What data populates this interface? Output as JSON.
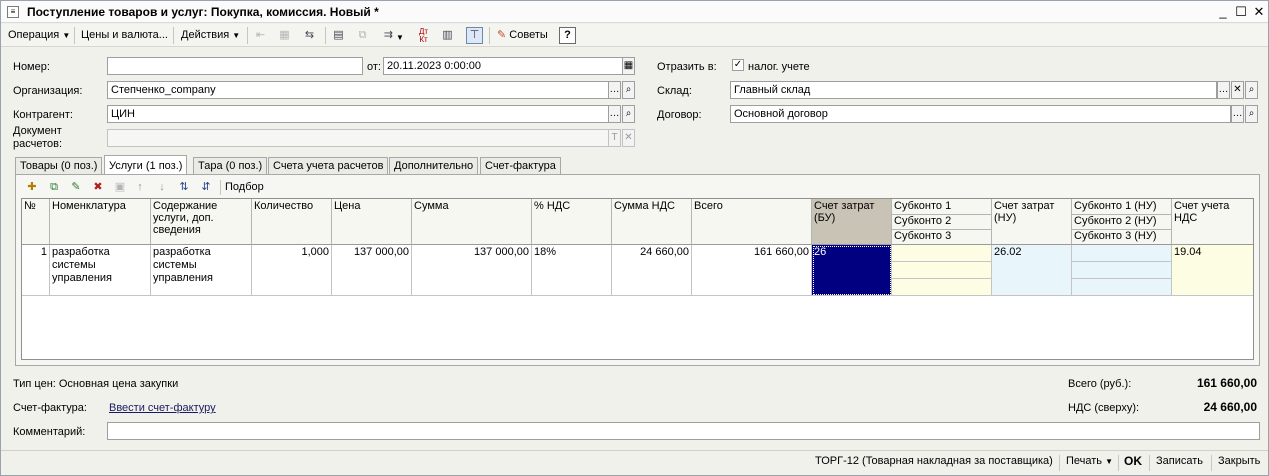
{
  "window": {
    "title": "Поступление товаров и услуг: Покупка, комиссия. Новый *",
    "minimize": "_",
    "maximize": "☐",
    "close": "✕"
  },
  "toolbar": {
    "operation": "Операция",
    "prices": "Цены и валюта...",
    "actions": "Действия",
    "tips": "Советы",
    "help": "?"
  },
  "form": {
    "number_label": "Номер:",
    "number_value": "",
    "date_label": "от:",
    "date_value": "20.11.2023  0:00:00",
    "reflect_label": "Отразить в:",
    "tax_check_label": "налог. учете",
    "org_label": "Организация:",
    "org_value": "Степченко_company",
    "warehouse_label": "Склад:",
    "warehouse_value": "Главный склад",
    "contractor_label": "Контрагент:",
    "contractor_value": "ЦИН",
    "contract_label": "Договор:",
    "contract_value": "Основной договор",
    "settle_doc_label_1": "Документ",
    "settle_doc_label_2": "расчетов:",
    "settle_doc_value": ""
  },
  "tabs": [
    {
      "label": "Товары (0 поз.)"
    },
    {
      "label": "Услуги (1 поз.)"
    },
    {
      "label": "Тара (0 поз.)"
    },
    {
      "label": "Счета учета расчетов"
    },
    {
      "label": "Дополнительно"
    },
    {
      "label": "Счет-фактура"
    }
  ],
  "grid_toolbar": {
    "select": "Подбор"
  },
  "grid": {
    "headers": {
      "n": "№",
      "nomenclature": "Номенклатура",
      "content": "Содержание услуги, доп. сведения",
      "qty": "Количество",
      "price": "Цена",
      "sum": "Сумма",
      "vat_rate": "% НДС",
      "vat_sum": "Сумма НДС",
      "total": "Всего",
      "cost_bu": "Счет затрат (БУ)",
      "sub1": "Субконто 1",
      "sub2": "Субконто 2",
      "sub3": "Субконто 3",
      "cost_nu": "Счет затрат (НУ)",
      "sub1_nu": "Субконто 1 (НУ)",
      "sub2_nu": "Субконто 2 (НУ)",
      "sub3_nu": "Субконто 3 (НУ)",
      "vat_account": "Счет учета НДС"
    },
    "rows": [
      {
        "n": "1",
        "nomenclature": "разработка системы управления",
        "content": "разработка системы управления",
        "qty": "1,000",
        "price": "137 000,00",
        "sum": "137 000,00",
        "vat_rate": "18%",
        "vat_sum": "24 660,00",
        "total": "161 660,00",
        "cost_bu": "26",
        "cost_nu": "26.02",
        "vat_account": "19.04"
      }
    ]
  },
  "footer": {
    "price_type": "Тип цен: Основная цена закупки",
    "invoice_label": "Счет-фактура:",
    "invoice_link": "Ввести счет-фактуру",
    "comment_label": "Комментарий:",
    "comment_value": "",
    "total_label": "Всего (руб.):",
    "total_value": "161 660,00",
    "vat_label": "НДС (сверху):",
    "vat_value": "24 660,00"
  },
  "statusbar": {
    "torg": "ТОРГ-12 (Товарная накладная за поставщика)",
    "print": "Печать",
    "ok": "OK",
    "save": "Записать",
    "close": "Закрыть"
  },
  "colors": {
    "selected_cell": "#000080",
    "subconto_bg": "#fdfde4",
    "nu_bg": "#e8f6fc"
  }
}
